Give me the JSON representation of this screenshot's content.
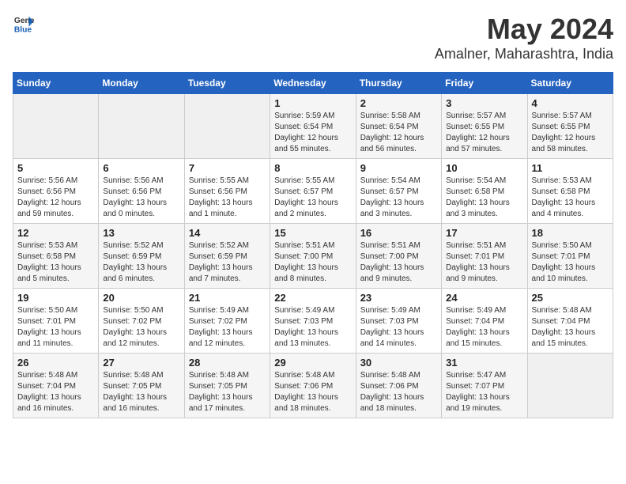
{
  "header": {
    "logo_general": "General",
    "logo_blue": "Blue",
    "main_title": "May 2024",
    "subtitle": "Amalner, Maharashtra, India"
  },
  "days_of_week": [
    "Sunday",
    "Monday",
    "Tuesday",
    "Wednesday",
    "Thursday",
    "Friday",
    "Saturday"
  ],
  "weeks": [
    [
      {
        "day": "",
        "empty": true
      },
      {
        "day": "",
        "empty": true
      },
      {
        "day": "",
        "empty": true
      },
      {
        "day": "1",
        "sunrise": "5:59 AM",
        "sunset": "6:54 PM",
        "daylight": "12 hours and 55 minutes."
      },
      {
        "day": "2",
        "sunrise": "5:58 AM",
        "sunset": "6:54 PM",
        "daylight": "12 hours and 56 minutes."
      },
      {
        "day": "3",
        "sunrise": "5:57 AM",
        "sunset": "6:55 PM",
        "daylight": "12 hours and 57 minutes."
      },
      {
        "day": "4",
        "sunrise": "5:57 AM",
        "sunset": "6:55 PM",
        "daylight": "12 hours and 58 minutes."
      }
    ],
    [
      {
        "day": "5",
        "sunrise": "5:56 AM",
        "sunset": "6:56 PM",
        "daylight": "12 hours and 59 minutes."
      },
      {
        "day": "6",
        "sunrise": "5:56 AM",
        "sunset": "6:56 PM",
        "daylight": "13 hours and 0 minutes."
      },
      {
        "day": "7",
        "sunrise": "5:55 AM",
        "sunset": "6:56 PM",
        "daylight": "13 hours and 1 minute."
      },
      {
        "day": "8",
        "sunrise": "5:55 AM",
        "sunset": "6:57 PM",
        "daylight": "13 hours and 2 minutes."
      },
      {
        "day": "9",
        "sunrise": "5:54 AM",
        "sunset": "6:57 PM",
        "daylight": "13 hours and 3 minutes."
      },
      {
        "day": "10",
        "sunrise": "5:54 AM",
        "sunset": "6:58 PM",
        "daylight": "13 hours and 3 minutes."
      },
      {
        "day": "11",
        "sunrise": "5:53 AM",
        "sunset": "6:58 PM",
        "daylight": "13 hours and 4 minutes."
      }
    ],
    [
      {
        "day": "12",
        "sunrise": "5:53 AM",
        "sunset": "6:58 PM",
        "daylight": "13 hours and 5 minutes."
      },
      {
        "day": "13",
        "sunrise": "5:52 AM",
        "sunset": "6:59 PM",
        "daylight": "13 hours and 6 minutes."
      },
      {
        "day": "14",
        "sunrise": "5:52 AM",
        "sunset": "6:59 PM",
        "daylight": "13 hours and 7 minutes."
      },
      {
        "day": "15",
        "sunrise": "5:51 AM",
        "sunset": "7:00 PM",
        "daylight": "13 hours and 8 minutes."
      },
      {
        "day": "16",
        "sunrise": "5:51 AM",
        "sunset": "7:00 PM",
        "daylight": "13 hours and 9 minutes."
      },
      {
        "day": "17",
        "sunrise": "5:51 AM",
        "sunset": "7:01 PM",
        "daylight": "13 hours and 9 minutes."
      },
      {
        "day": "18",
        "sunrise": "5:50 AM",
        "sunset": "7:01 PM",
        "daylight": "13 hours and 10 minutes."
      }
    ],
    [
      {
        "day": "19",
        "sunrise": "5:50 AM",
        "sunset": "7:01 PM",
        "daylight": "13 hours and 11 minutes."
      },
      {
        "day": "20",
        "sunrise": "5:50 AM",
        "sunset": "7:02 PM",
        "daylight": "13 hours and 12 minutes."
      },
      {
        "day": "21",
        "sunrise": "5:49 AM",
        "sunset": "7:02 PM",
        "daylight": "13 hours and 12 minutes."
      },
      {
        "day": "22",
        "sunrise": "5:49 AM",
        "sunset": "7:03 PM",
        "daylight": "13 hours and 13 minutes."
      },
      {
        "day": "23",
        "sunrise": "5:49 AM",
        "sunset": "7:03 PM",
        "daylight": "13 hours and 14 minutes."
      },
      {
        "day": "24",
        "sunrise": "5:49 AM",
        "sunset": "7:04 PM",
        "daylight": "13 hours and 15 minutes."
      },
      {
        "day": "25",
        "sunrise": "5:48 AM",
        "sunset": "7:04 PM",
        "daylight": "13 hours and 15 minutes."
      }
    ],
    [
      {
        "day": "26",
        "sunrise": "5:48 AM",
        "sunset": "7:04 PM",
        "daylight": "13 hours and 16 minutes."
      },
      {
        "day": "27",
        "sunrise": "5:48 AM",
        "sunset": "7:05 PM",
        "daylight": "13 hours and 16 minutes."
      },
      {
        "day": "28",
        "sunrise": "5:48 AM",
        "sunset": "7:05 PM",
        "daylight": "13 hours and 17 minutes."
      },
      {
        "day": "29",
        "sunrise": "5:48 AM",
        "sunset": "7:06 PM",
        "daylight": "13 hours and 18 minutes."
      },
      {
        "day": "30",
        "sunrise": "5:48 AM",
        "sunset": "7:06 PM",
        "daylight": "13 hours and 18 minutes."
      },
      {
        "day": "31",
        "sunrise": "5:47 AM",
        "sunset": "7:07 PM",
        "daylight": "13 hours and 19 minutes."
      },
      {
        "day": "",
        "empty": true
      }
    ]
  ]
}
